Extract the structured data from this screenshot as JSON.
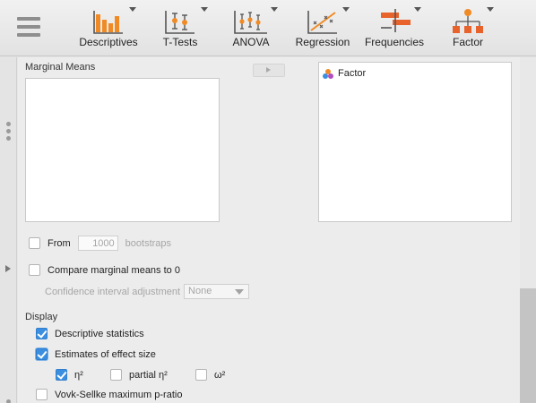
{
  "toolbar": {
    "menu_icon": "hamburger-menu-icon",
    "tools": [
      {
        "label": "Descriptives",
        "icon": "bar-chart-icon"
      },
      {
        "label": "T-Tests",
        "icon": "ttest-icon"
      },
      {
        "label": "ANOVA",
        "icon": "anova-icon"
      },
      {
        "label": "Regression",
        "icon": "regression-icon"
      },
      {
        "label": "Frequencies",
        "icon": "frequencies-icon"
      },
      {
        "label": "Factor",
        "icon": "factor-hierarchy-icon"
      }
    ]
  },
  "marginal_means": {
    "title": "Marginal Means",
    "assigned_items": [],
    "available_items": [
      {
        "label": "Factor",
        "icon": "factor-variable-icon"
      }
    ]
  },
  "bootstraps": {
    "from_label": "From",
    "checked": false,
    "value": "1000",
    "suffix": "bootstraps"
  },
  "compare": {
    "label": "Compare marginal means to 0",
    "checked": false,
    "ci_adjust_label": "Confidence interval adjustment",
    "ci_adjust_value": "None"
  },
  "display": {
    "title": "Display",
    "descriptive_statistics": {
      "label": "Descriptive statistics",
      "checked": true
    },
    "effect_size": {
      "label": "Estimates of effect size",
      "checked": true
    },
    "eta_squared": {
      "label": "η²",
      "checked": true
    },
    "partial_eta_squared": {
      "label": "partial η²",
      "checked": false
    },
    "omega_squared": {
      "label": "ω²",
      "checked": false
    },
    "vovk_sellke": {
      "label": "Vovk-Sellke maximum p-ratio",
      "checked": false
    }
  },
  "colors": {
    "accent": "#3b8ee0",
    "descriptives_orange": "#f08a24",
    "panel_bg": "#ececec"
  }
}
